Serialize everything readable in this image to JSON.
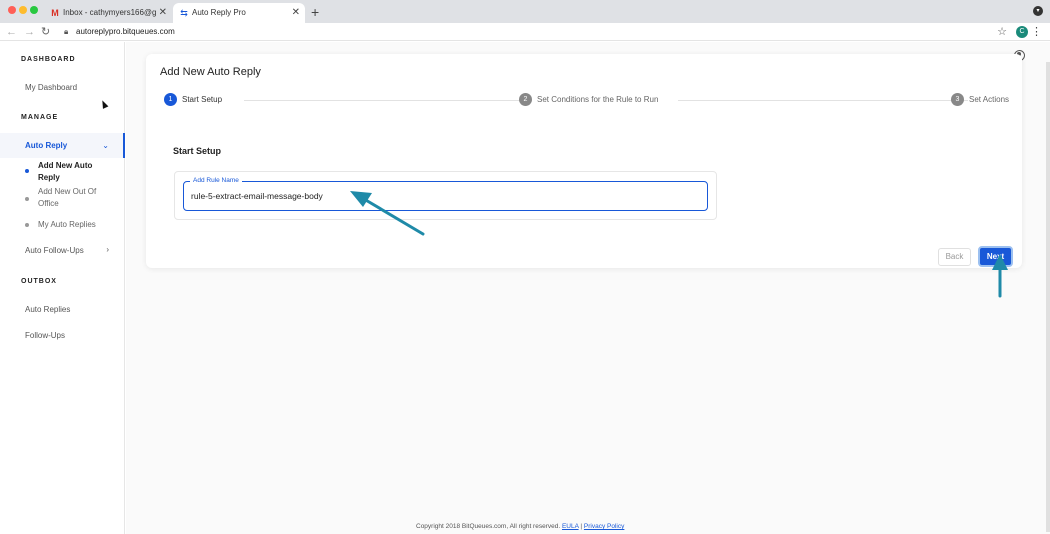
{
  "browser": {
    "tabs": [
      {
        "title": "Inbox - cathymyers166@gmail.",
        "favicon": "gmail-icon"
      },
      {
        "title": "Auto Reply Pro",
        "favicon": "app-icon"
      }
    ],
    "url": "autoreplypro.bitqueues.com",
    "profile_initial": "C"
  },
  "sidebar": {
    "dashboard_heading": "DASHBOARD",
    "my_dashboard": "My Dashboard",
    "manage_heading": "MANAGE",
    "auto_reply": "Auto Reply",
    "sub_items": [
      "Add New Auto Reply",
      "Add New Out Of Office",
      "My Auto Replies"
    ],
    "auto_follow_ups": "Auto Follow-Ups",
    "outbox_heading": "OUTBOX",
    "auto_replies": "Auto Replies",
    "follow_ups": "Follow-Ups"
  },
  "main": {
    "title": "Add New Auto Reply",
    "steps": [
      {
        "num": "1",
        "label": "Start Setup"
      },
      {
        "num": "2",
        "label": "Set Conditions for the Rule to Run"
      },
      {
        "num": "3",
        "label": "Set Actions"
      }
    ],
    "section_title": "Start Setup",
    "rule_name_label": "Add Rule Name",
    "rule_name_value": "rule-5-extract-email-message-body",
    "back_label": "Back",
    "next_label": "Next"
  },
  "footer": {
    "copyright": "Copyright 2018 BitQueues.com, All right reserved.",
    "eula": "EULA",
    "separator": "|",
    "privacy": "Privacy Policy"
  },
  "colors": {
    "accent": "#1858d8",
    "annotation_arrow": "#1f8aa8"
  }
}
